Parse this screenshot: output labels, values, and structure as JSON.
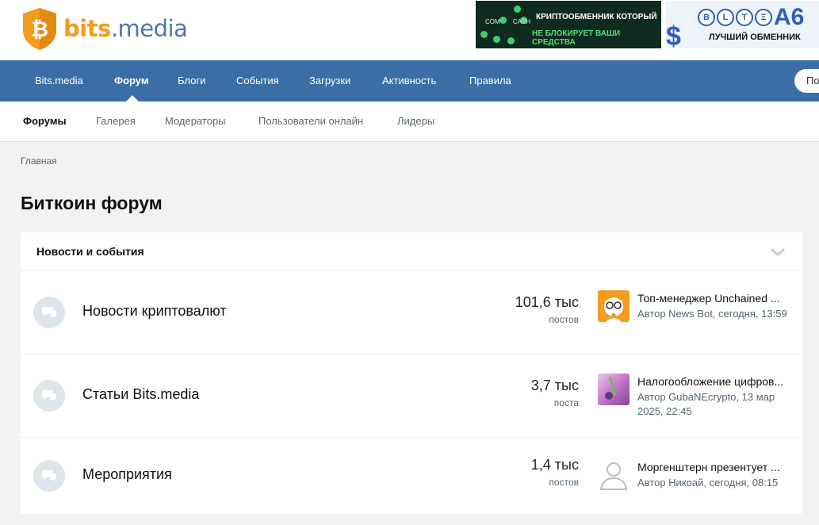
{
  "logo": {
    "bits": "bits",
    "media": ".media"
  },
  "banner1": {
    "com_label": "COM",
    "cash_label": "CASH",
    "line1": "КРИПТООБМЕННИК КОТОРЫЙ",
    "line2": "НЕ БЛОКИРУЕТ ВАШИ СРЕДСТВА"
  },
  "banner2": {
    "coins": [
      "B",
      "L",
      "T",
      "Ξ"
    ],
    "brand": "A6",
    "tagline": "ЛУЧШИЙ ОБМЕННИК",
    "dollar": "$"
  },
  "main_nav": {
    "items": [
      "Bits.media",
      "Форум",
      "Блоги",
      "События",
      "Загрузки",
      "Активность",
      "Правила"
    ],
    "active": "Форум",
    "search_placeholder": "По"
  },
  "sub_nav": {
    "items": [
      "Форумы",
      "Галерея",
      "Модераторы",
      "Пользователи онлайн",
      "Лидеры"
    ],
    "active": "Форумы"
  },
  "breadcrumb": "Главная",
  "page_title": "Биткоин форум",
  "section": {
    "title": "Новости и события",
    "forums": [
      {
        "title": "Новости криптовалют",
        "count": "101,6 тыс",
        "count_label": "постов",
        "last_post_title": "Топ-менеджер Unchained ...",
        "last_post_meta": "Автор News Bot, сегодня, 13:59",
        "avatar": "news-bot"
      },
      {
        "title": "Статьи Bits.media",
        "count": "3,7 тыс",
        "count_label": "поста",
        "last_post_title": "Налогообложение цифров...",
        "last_post_meta": "Автор GubaNEcrypto, 13 мар 2025, 22:45",
        "avatar": "photo"
      },
      {
        "title": "Мероприятия",
        "count": "1,4 тыс",
        "count_label": "постов",
        "last_post_title": "Моргенштерн презентует ...",
        "last_post_meta": "Автор Никоай, сегодня, 08:15",
        "avatar": "default-user"
      }
    ]
  },
  "colors": {
    "nav": "#3a6ea5",
    "brand_orange": "#f39c1f",
    "brand_blue": "#4a79a8"
  }
}
